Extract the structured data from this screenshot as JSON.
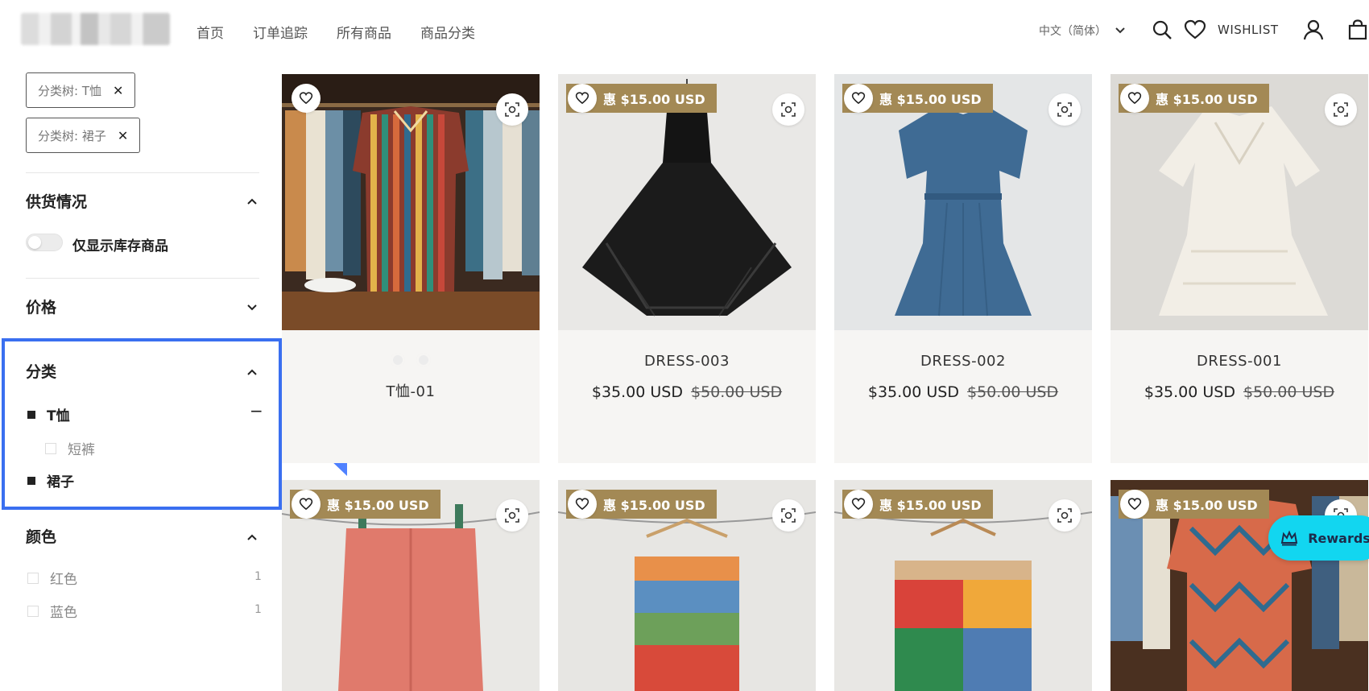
{
  "header": {
    "nav": [
      "首页",
      "订单追踪",
      "所有商品",
      "商品分类"
    ],
    "language": "中文（简体）",
    "wishlist_label": "WISHLIST",
    "icons": [
      "search-icon",
      "heart-icon",
      "user-icon",
      "bag-icon",
      "chevron-down-icon"
    ]
  },
  "filters": {
    "active_chips": [
      "分类树: T恤",
      "分类树: 裙子"
    ],
    "availability": {
      "title": "供货情况",
      "toggle_label": "仅显示库存商品",
      "toggle_on": false
    },
    "price": {
      "title": "价格"
    },
    "category": {
      "title": "分类",
      "items": [
        {
          "label": "T恤",
          "state": "selected"
        },
        {
          "label": "短裤",
          "state": "unchecked"
        },
        {
          "label": "裙子",
          "state": "selected"
        }
      ]
    },
    "color": {
      "title": "颜色",
      "items": [
        {
          "label": "红色",
          "count": "1"
        },
        {
          "label": "蓝色",
          "count": "1"
        }
      ]
    }
  },
  "products": [
    {
      "name": "T恤-01",
      "price": "",
      "old_price": "",
      "badge": "",
      "has_swatches": true
    },
    {
      "name": "DRESS-003",
      "price": "$35.00 USD",
      "old_price": "$50.00 USD",
      "badge": "惠 $15.00 USD"
    },
    {
      "name": "DRESS-002",
      "price": "$35.00 USD",
      "old_price": "$50.00 USD",
      "badge": "惠 $15.00 USD"
    },
    {
      "name": "DRESS-001",
      "price": "$35.00 USD",
      "old_price": "$50.00 USD",
      "badge": "惠 $15.00 USD"
    },
    {
      "name": "",
      "badge": "惠 $15.00 USD"
    },
    {
      "name": "",
      "badge": "惠 $15.00 USD"
    },
    {
      "name": "",
      "badge": "惠 $15.00 USD"
    },
    {
      "name": "",
      "badge": "惠 $15.00 USD"
    }
  ],
  "rewards_label": "Rewards",
  "colors": {
    "accent": "#3a6ff0",
    "badge": "#a38955",
    "rewards": "#12d6f0"
  }
}
